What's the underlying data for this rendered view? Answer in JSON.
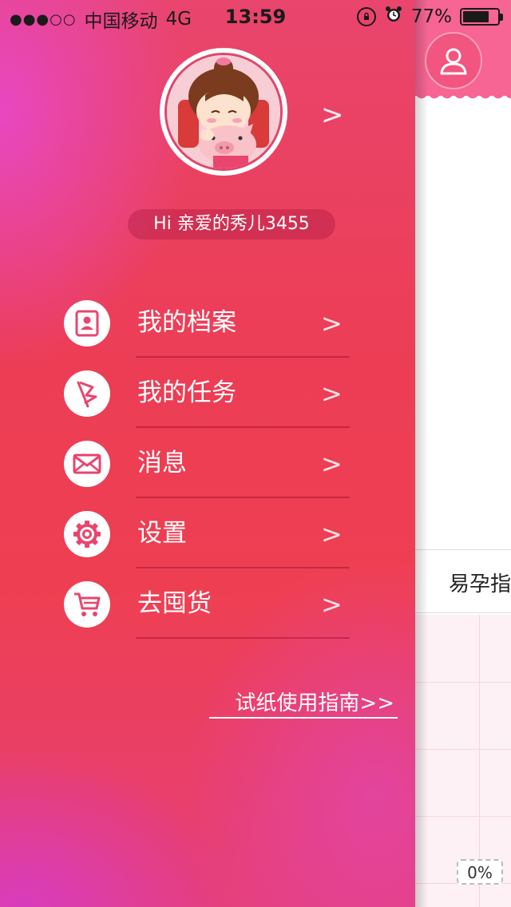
{
  "status_bar": {
    "signal": "●●●○○",
    "carrier": "中国移动",
    "network": "4G",
    "time": "13:59",
    "battery": "77%"
  },
  "profile": {
    "greeting": "Hi 亲爱的秀儿3455",
    "arrow": ">"
  },
  "menu": {
    "items": [
      {
        "label": "我的档案",
        "icon": "profile-card-icon",
        "arrow": ">"
      },
      {
        "label": "我的任务",
        "icon": "flag-icon",
        "arrow": ">"
      },
      {
        "label": "消息",
        "icon": "envelope-icon",
        "arrow": ">"
      },
      {
        "label": "设置",
        "icon": "gear-icon",
        "arrow": ">"
      },
      {
        "label": "去囤货",
        "icon": "cart-icon",
        "arrow": ">"
      }
    ]
  },
  "guide_link": "试纸使用指南>>",
  "main": {
    "tab_label": "易孕指",
    "progress": "0%"
  },
  "colors": {
    "drawer_accent": "#ee3f52",
    "icon_pink": "#e8456f",
    "header_pink": "#f66593"
  }
}
